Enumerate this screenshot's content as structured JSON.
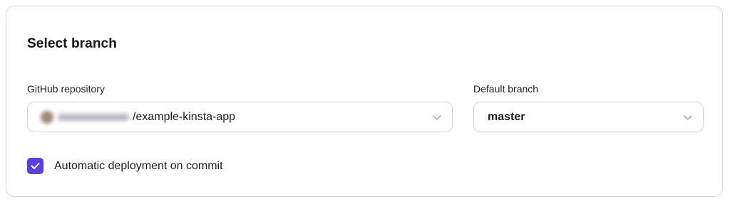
{
  "section": {
    "title": "Select branch"
  },
  "repository": {
    "label": "GitHub repository",
    "value": "/example-kinsta-app",
    "owner_obscured": true,
    "icon": "chevron-down-icon"
  },
  "branch": {
    "label": "Default branch",
    "value": "master",
    "icon": "chevron-down-icon"
  },
  "auto_deploy": {
    "label": "Automatic deployment on commit",
    "checked": true,
    "icon": "checkmark-icon"
  },
  "colors": {
    "accent": "#5b3fe0",
    "border": "#d4d4d8",
    "text": "#1c1c1c"
  }
}
